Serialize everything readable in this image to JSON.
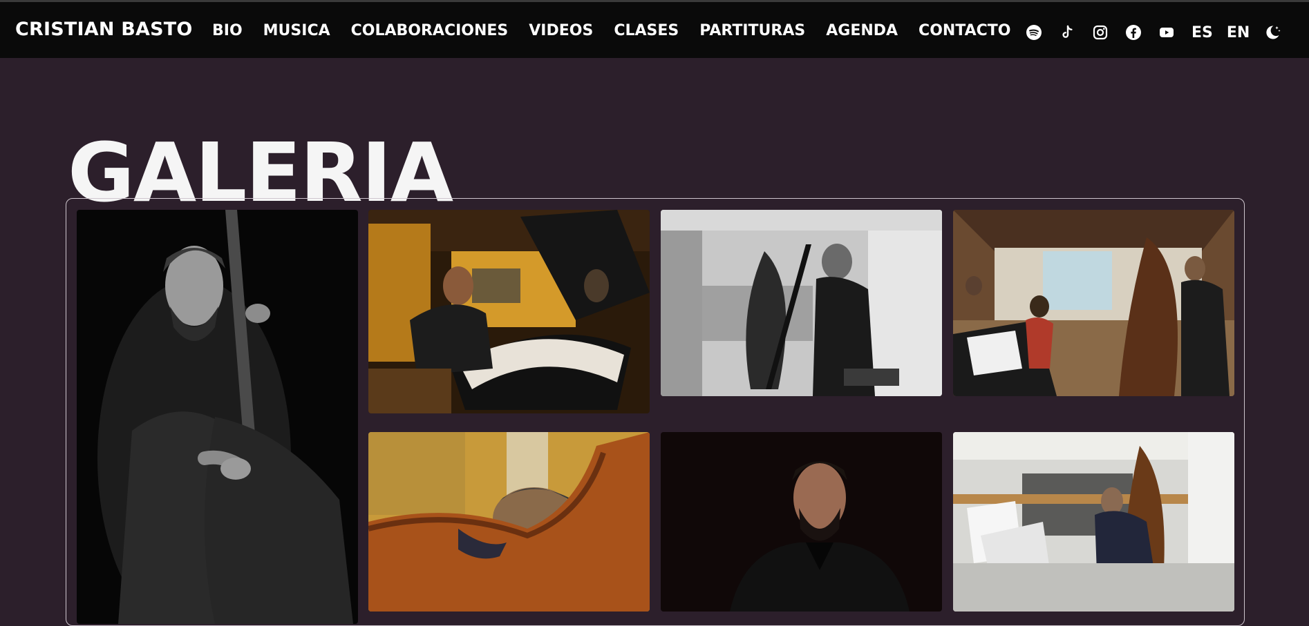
{
  "header": {
    "brand": "CRISTIAN BASTO",
    "nav": [
      {
        "label": "BIO"
      },
      {
        "label": "MUSICA"
      },
      {
        "label": "COLABORACIONES"
      },
      {
        "label": "VIDEOS"
      },
      {
        "label": "CLASES"
      },
      {
        "label": "PARTITURAS"
      },
      {
        "label": "AGENDA"
      },
      {
        "label": "CONTACTO"
      }
    ],
    "social_icons": [
      "spotify-icon",
      "tiktok-icon",
      "instagram-icon",
      "facebook-icon",
      "youtube-icon"
    ],
    "languages": [
      "ES",
      "EN"
    ],
    "theme_icon": "moon-icon"
  },
  "page": {
    "title": "GALERIA"
  },
  "gallery": {
    "photos": [
      {
        "subject": "bassist-portrait-bw"
      },
      {
        "subject": "pianist-fisheye-studio"
      },
      {
        "subject": "bassist-headphones-studio-bw"
      },
      {
        "subject": "ensemble-fisheye-room"
      },
      {
        "subject": "face-behind-double-bass"
      },
      {
        "subject": "portrait-black-suit"
      },
      {
        "subject": "bassist-recording-studio"
      }
    ]
  },
  "colors": {
    "topbar": "#0a0a0a",
    "background": "#2c1f2b",
    "text": "#ffffff",
    "frame_border": "#cfc6ce"
  }
}
